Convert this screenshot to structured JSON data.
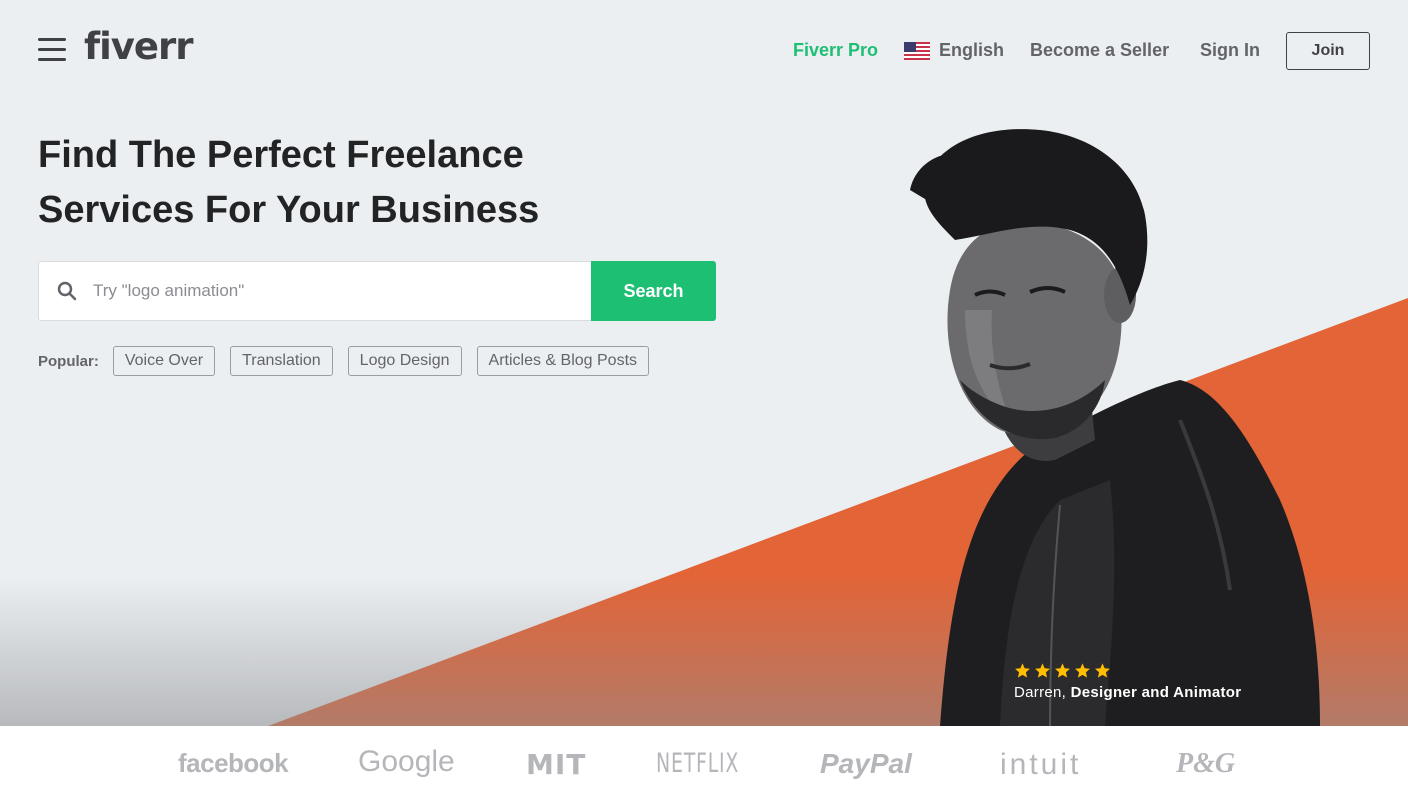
{
  "header": {
    "logo": "fiverr",
    "nav": {
      "fiverr_pro": "Fiverr Pro",
      "language": "English",
      "become_seller": "Become a Seller",
      "sign_in": "Sign In",
      "join": "Join"
    }
  },
  "hero": {
    "headline_line1": "Find The Perfect Freelance",
    "headline_line2": "Services For Your Business",
    "search": {
      "placeholder": "Try \"logo animation\"",
      "button": "Search"
    },
    "popular": {
      "label": "Popular:",
      "tags": [
        "Voice Over",
        "Translation",
        "Logo Design",
        "Articles & Blog Posts"
      ]
    },
    "testimonial": {
      "rating": 5,
      "name": "Darren,",
      "role": "Designer and Animator"
    }
  },
  "trusted_by": [
    "facebook",
    "Google",
    "MIT",
    "NETFLIX",
    "PayPal",
    "intuit",
    "P&G"
  ],
  "colors": {
    "brand_green": "#1dbf73",
    "accent_orange": "#e26437",
    "hero_bg": "#eceff2",
    "star": "#ffbe00"
  }
}
